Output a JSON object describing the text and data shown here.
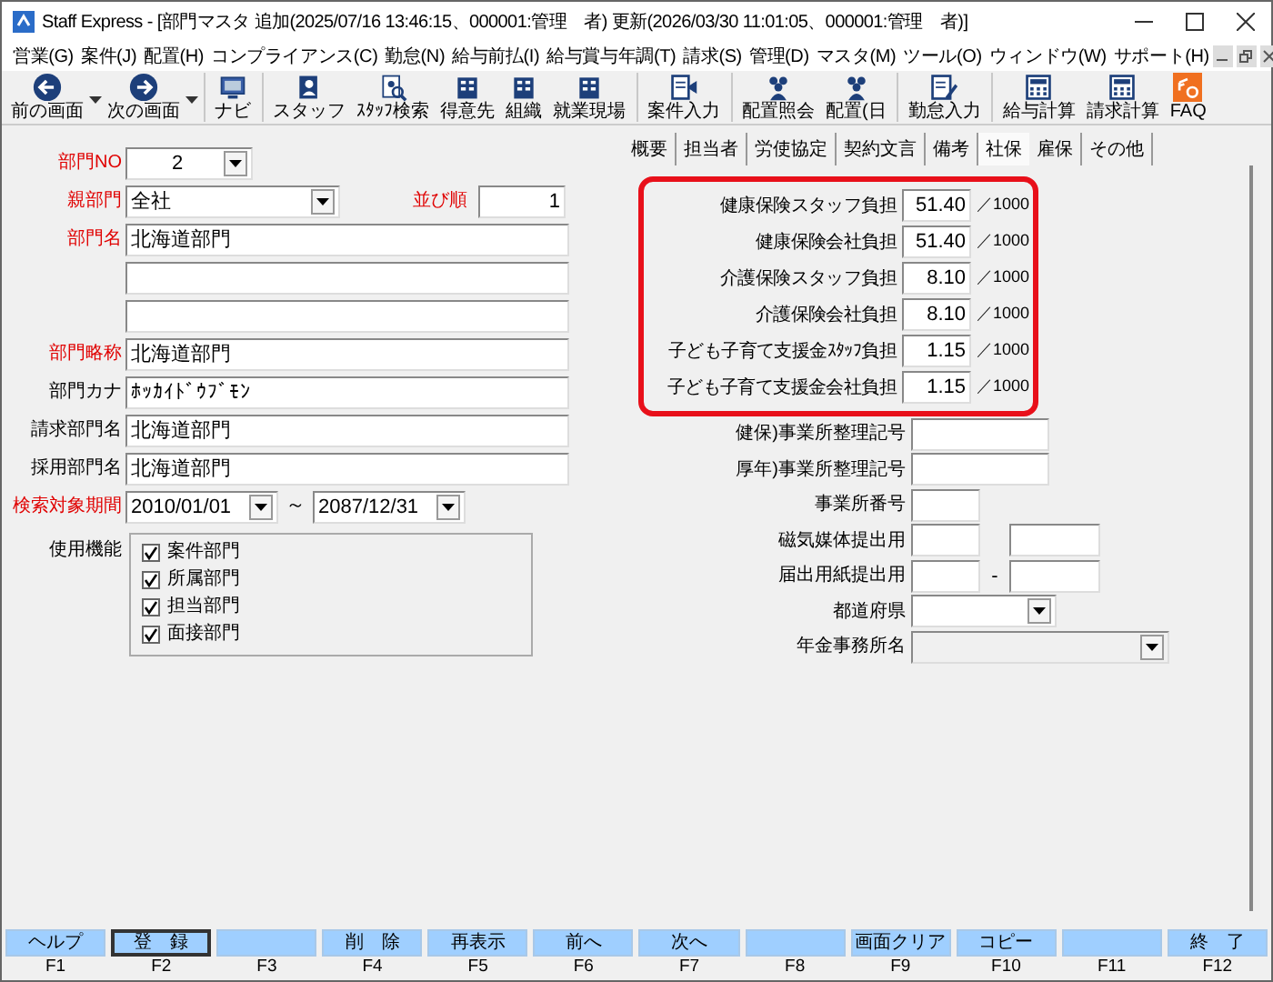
{
  "window": {
    "title": "Staff Express - [部門マスタ 追加(2025/07/16 13:46:15、000001:管理　者) 更新(2026/03/30 11:01:05、000001:管理　者)]"
  },
  "menu": [
    "営業(G)",
    "案件(J)",
    "配置(H)",
    "コンプライアンス(C)",
    "勤怠(N)",
    "給与前払(I)",
    "給与賞与年調(T)",
    "請求(S)",
    "管理(D)",
    "マスタ(M)",
    "ツール(O)",
    "ウィンドウ(W)",
    "サポート(H)"
  ],
  "toolbar": [
    {
      "label": "前の画面",
      "kind": "back",
      "dropdown": true,
      "separator_before": false
    },
    {
      "label": "次の画面",
      "kind": "forward",
      "dropdown": true,
      "separator_before": false
    },
    {
      "label": "ナビ",
      "kind": "monitor",
      "dropdown": false,
      "separator_before": true
    },
    {
      "label": "スタッフ",
      "kind": "person",
      "dropdown": false,
      "separator_before": true
    },
    {
      "label": "ｽﾀｯﾌ検索",
      "kind": "person-search",
      "dropdown": false,
      "separator_before": false
    },
    {
      "label": "得意先",
      "kind": "building",
      "dropdown": false,
      "separator_before": false
    },
    {
      "label": "組織",
      "kind": "building",
      "dropdown": false,
      "separator_before": false
    },
    {
      "label": "就業現場",
      "kind": "building",
      "dropdown": false,
      "separator_before": false
    },
    {
      "label": "案件入力",
      "kind": "document-arrow",
      "dropdown": false,
      "separator_before": true
    },
    {
      "label": "配置照会",
      "kind": "people",
      "dropdown": false,
      "separator_before": true
    },
    {
      "label": "配置(日",
      "kind": "people",
      "dropdown": false,
      "separator_before": false
    },
    {
      "label": "勤怠入力",
      "kind": "document-pen",
      "dropdown": false,
      "separator_before": true
    },
    {
      "label": "給与計算",
      "kind": "calculator",
      "dropdown": false,
      "separator_before": true
    },
    {
      "label": "請求計算",
      "kind": "calculator",
      "dropdown": false,
      "separator_before": false
    },
    {
      "label": "FAQ",
      "kind": "faq",
      "dropdown": false,
      "separator_before": false
    }
  ],
  "left": {
    "dept_no": {
      "label": "部門NO",
      "required": true,
      "value": "2"
    },
    "parent": {
      "label": "親部門",
      "required": true,
      "value": "全社"
    },
    "order": {
      "label": "並び順",
      "required": true,
      "value": "1"
    },
    "text_rows": [
      {
        "label": "部門名",
        "required": true,
        "value": "北海道部門"
      },
      {},
      {},
      {
        "label": "部門略称",
        "required": true,
        "value": "北海道部門"
      },
      {
        "label": "部門カナ",
        "required": false,
        "value": "ﾎｯｶｲﾄﾞｳﾌﾞﾓﾝ"
      },
      {
        "label": "請求部門名",
        "required": false,
        "value": "北海道部門"
      },
      {
        "label": "採用部門名",
        "required": false,
        "value": "北海道部門"
      }
    ],
    "period": {
      "label": "検索対象期間",
      "required": true,
      "from": "2010/01/01",
      "separator": "～",
      "to": "2087/12/31"
    },
    "functions": {
      "label": "使用機能",
      "options": [
        {
          "label": "案件部門",
          "checked": true
        },
        {
          "label": "所属部門",
          "checked": true
        },
        {
          "label": "担当部門",
          "checked": true
        },
        {
          "label": "面接部門",
          "checked": true
        }
      ]
    }
  },
  "right": {
    "tabs": [
      {
        "label": "概要",
        "selected": false
      },
      {
        "label": "担当者",
        "selected": false
      },
      {
        "label": "労使協定",
        "selected": false
      },
      {
        "label": "契約文言",
        "selected": false
      },
      {
        "label": "備考",
        "selected": false
      },
      {
        "label": "社保",
        "selected": true
      },
      {
        "label": "雇保",
        "selected": false
      },
      {
        "label": "その他",
        "selected": false
      }
    ],
    "rates_highlighted": true,
    "rates": [
      {
        "label": "健康保険スタッフ負担",
        "value": "51.40",
        "unit": "／1000"
      },
      {
        "label": "健康保険会社負担",
        "value": "51.40",
        "unit": "／1000"
      },
      {
        "label": "介護保険スタッフ負担",
        "value": "8.10",
        "unit": "／1000"
      },
      {
        "label": "介護保険会社負担",
        "value": "8.10",
        "unit": "／1000"
      },
      {
        "label": "子ども子育て支援金ｽﾀｯﾌ負担",
        "value": "1.15",
        "unit": "／1000"
      },
      {
        "label": "子ども子育て支援金会社負担",
        "value": "1.15",
        "unit": "／1000"
      }
    ],
    "fields": [
      {
        "label": "健保)事業所整理記号",
        "kind": "medium",
        "disabled": false
      },
      {
        "label": "厚年)事業所整理記号",
        "kind": "medium",
        "disabled": false
      },
      {
        "label": "事業所番号",
        "kind": "short",
        "disabled": false
      },
      {
        "label": "磁気媒体提出用",
        "kind": "pair",
        "disabled": false
      },
      {
        "label": "届出用紙提出用",
        "kind": "pair",
        "separator": "-",
        "disabled": false
      },
      {
        "label": "都道府県",
        "kind": "select",
        "disabled": false
      },
      {
        "label": "年金事務所名",
        "kind": "select-wide",
        "disabled": true
      }
    ]
  },
  "function_keys": [
    {
      "label": "ヘルプ",
      "key": "F1",
      "focused": false
    },
    {
      "label": "登　録",
      "key": "F2",
      "focused": true
    },
    {
      "key": "F3",
      "focused": false
    },
    {
      "label": "削　除",
      "key": "F4",
      "focused": false
    },
    {
      "label": "再表示",
      "key": "F5",
      "focused": false
    },
    {
      "label": "前へ",
      "key": "F6",
      "focused": false
    },
    {
      "label": "次へ",
      "key": "F7",
      "focused": false
    },
    {
      "key": "F8",
      "focused": false
    },
    {
      "label": "画面クリア",
      "key": "F9",
      "focused": false
    },
    {
      "label": "コピー",
      "key": "F10",
      "focused": false
    },
    {
      "key": "F11",
      "focused": false
    },
    {
      "label": "終　了",
      "key": "F12",
      "focused": false
    }
  ]
}
